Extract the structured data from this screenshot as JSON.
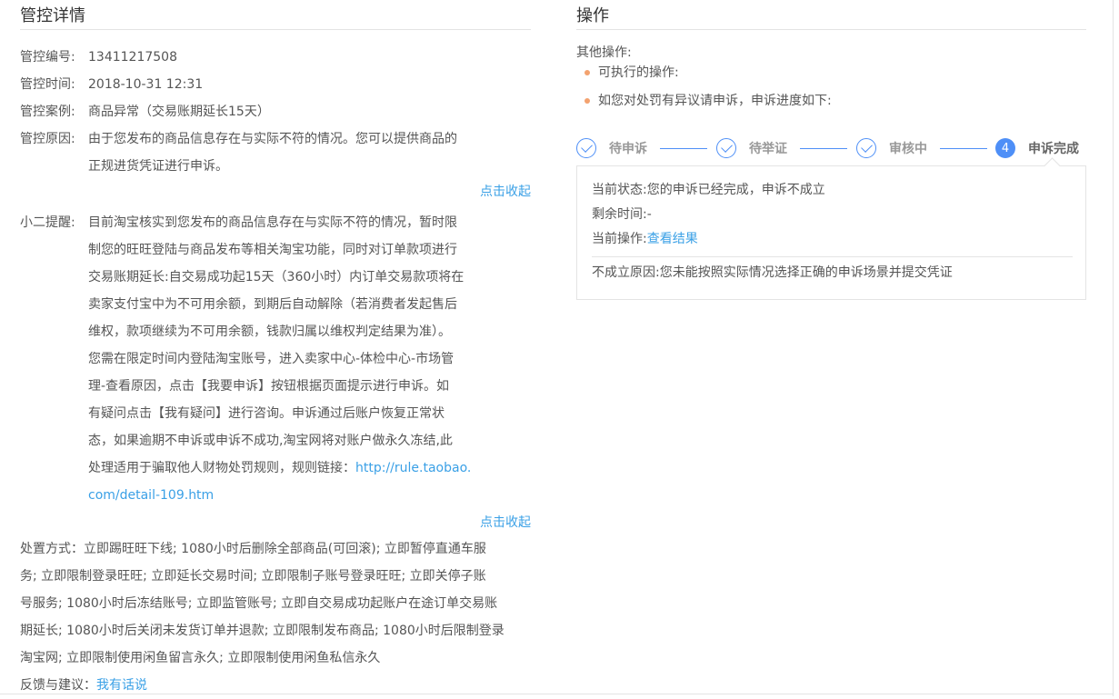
{
  "detail": {
    "title": "管控详情",
    "fields": [
      {
        "label": "管控编号:",
        "value": "13411217508"
      },
      {
        "label": "管控时间:",
        "value": "2018-10-31 12:31"
      },
      {
        "label": "管控案例:",
        "value": "商品异常（交易账期延长15天）"
      }
    ],
    "reason": {
      "label": "管控原因:",
      "lines": [
        "由于您发布的商品信息存在与实际不符的情况。您可以提供商品的",
        "正规进货凭证进行申诉。"
      ]
    },
    "collapse_label": "点击收起",
    "tip": {
      "label": "小二提醒:",
      "lines": [
        "目前淘宝核实到您发布的商品信息存在与实际不符的情况，暂时限",
        "制您的旺旺登陆与商品发布等相关淘宝功能，同时对订单款项进行",
        "交易账期延长:自交易成功起15天（360小时）内订单交易款项将在",
        "卖家支付宝中为不可用余额，到期后自动解除（若消费者发起售后",
        "维权，款项继续为不可用余额，钱款归属以维权判定结果为准）。",
        "您需在限定时间内登陆淘宝账号，进入卖家中心-体检中心-市场管",
        "理-查看原因，点击【我要申诉】按钮根据页面提示进行申诉。如",
        "有疑问点击【我有疑问】进行咨询。申诉通过后账户恢复正常状",
        "态，如果逾期不申诉或申诉不成功,淘宝网将对账户做永久冻结,此"
      ],
      "last_line_prefix": "处理适用于骗取他人财物处罚规则，规则链接：",
      "rule_link_part1": "http://rule.taobao.",
      "rule_link_part2": "com/detail-109.htm"
    },
    "collapse_label2": "点击收起",
    "action_lines": [
      "处置方式：立即踢旺旺下线; 1080小时后删除全部商品(可回滚); 立即暂停直通车服",
      "务; 立即限制登录旺旺; 立即延长交易时间; 立即限制子账号登录旺旺; 立即关停子账",
      "号服务; 1080小时后冻结账号; 立即监管账号; 立即自交易成功起账户在途订单交易账",
      "期延长; 1080小时后关闭未发货订单并退款; 立即限制发布商品; 1080小时后限制登录",
      "淘宝网; 立即限制使用闲鱼留言永久; 立即限制使用闲鱼私信永久"
    ],
    "feedback_label": "反馈与建议：",
    "feedback_link": "我有话说"
  },
  "ops": {
    "title": "操作",
    "other_label": "其他操作:",
    "bullets": [
      "可执行的操作:",
      "如您对处罚有异议请申诉，申诉进度如下:"
    ],
    "steps": [
      {
        "label": "待申诉",
        "done": true
      },
      {
        "label": "待举证",
        "done": true
      },
      {
        "label": "审核中",
        "done": true
      },
      {
        "label": "申诉完成",
        "num": "4",
        "done": false
      }
    ],
    "status_label": "当前状态:",
    "status_value": "您的申诉已经完成，申诉不成立",
    "remain_label": "剩余时间:",
    "remain_value": "-",
    "op_label": "当前操作:",
    "op_link": "查看结果",
    "fail_label": "不成立原因:",
    "fail_value": "您未能按照实际情况选择正确的申诉场景并提交凭证"
  },
  "colors": {
    "accent": "#3aa0e6",
    "step": "#4e8ff7",
    "bullet": "#f3a26f"
  }
}
